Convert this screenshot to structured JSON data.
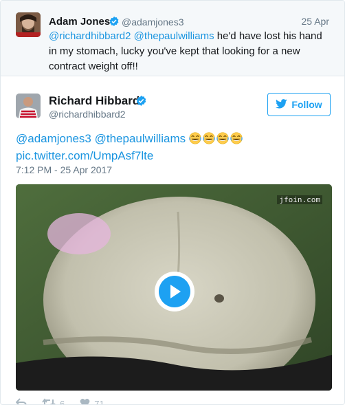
{
  "parent_tweet": {
    "name": "Adam Jones",
    "handle": "@adamjones3",
    "date": "25 Apr",
    "mention_1": "@richardhibbard2",
    "mention_2": "@thepaulwilliams",
    "text": " he'd have lost his hand in my stomach, lucky you've kept that looking for a new contract weight off!!"
  },
  "tweet": {
    "name": "Richard Hibbard",
    "handle": "@richardhibbard2",
    "follow_label": "Follow",
    "mention_1": "@adamjones3",
    "mention_2": "@thepaulwilliams",
    "emoji_count": 4,
    "emoji_name": "face-with-tears-of-joy",
    "link": "pic.twitter.com/UmpAsf7lte",
    "timestamp": "7:12 PM - 25 Apr 2017",
    "video_watermark": "jfoin.com",
    "retweet_count": "6",
    "like_count": "71"
  },
  "icons": {
    "verified": "verified-badge-icon",
    "twitter_bird": "twitter-bird-icon",
    "play": "play-icon",
    "reply": "reply-icon",
    "retweet": "retweet-icon",
    "like": "heart-icon"
  },
  "colors": {
    "accent": "#1da1f2",
    "link": "#1b95e0",
    "muted": "#657786",
    "parent_bg": "#f5f8fa"
  }
}
